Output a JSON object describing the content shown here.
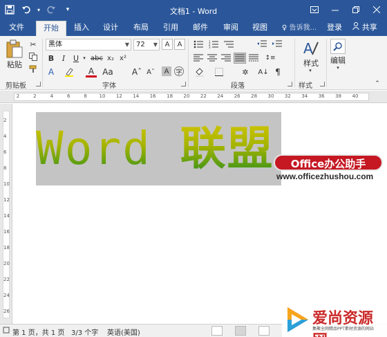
{
  "window": {
    "title": "文档1 - Word"
  },
  "qat": {
    "save": "save-icon",
    "undo": "undo-icon",
    "redo": "redo-icon",
    "customize": "▾"
  },
  "tabs": [
    {
      "label": "文件"
    },
    {
      "label": "开始"
    },
    {
      "label": "插入"
    },
    {
      "label": "设计"
    },
    {
      "label": "布局"
    },
    {
      "label": "引用"
    },
    {
      "label": "邮件"
    },
    {
      "label": "审阅"
    },
    {
      "label": "视图"
    },
    {
      "label": "告诉我..."
    },
    {
      "label": "登录"
    },
    {
      "label": "共享"
    }
  ],
  "ribbon": {
    "clipboard": {
      "paste": "粘贴",
      "label": "剪贴板"
    },
    "font": {
      "name": "黑体",
      "size": "72",
      "label": "字体"
    },
    "paragraph": {
      "label": "段落"
    },
    "styles": {
      "button": "样式",
      "label": "样式"
    },
    "editing": {
      "button": "编辑"
    }
  },
  "ruler": {
    "ticks": [
      "2",
      "2",
      "4",
      "6",
      "8",
      "10",
      "12",
      "14",
      "16",
      "18",
      "20",
      "22",
      "24",
      "26",
      "28",
      "30",
      "32",
      "34",
      "36",
      "38",
      "40"
    ],
    "vticks": [
      "2",
      "4",
      "6",
      "8",
      "10",
      "12",
      "14",
      "16",
      "18",
      "20",
      "22",
      "24",
      "26"
    ]
  },
  "document": {
    "wordart_latin": "Word ",
    "wordart_cjk": "联盟",
    "badge": "Office办公助手",
    "site": "www.officezhushou.com"
  },
  "status": {
    "page": "第 1 页，共 1 页",
    "words": "3/3 个字",
    "language": "英语(美国)"
  },
  "watermark": {
    "name": "爱尚资源网",
    "sub": "集聚全网精品PPT素材资源的网站"
  },
  "colors": {
    "accent": "#2b579a",
    "badge": "#c51822"
  }
}
